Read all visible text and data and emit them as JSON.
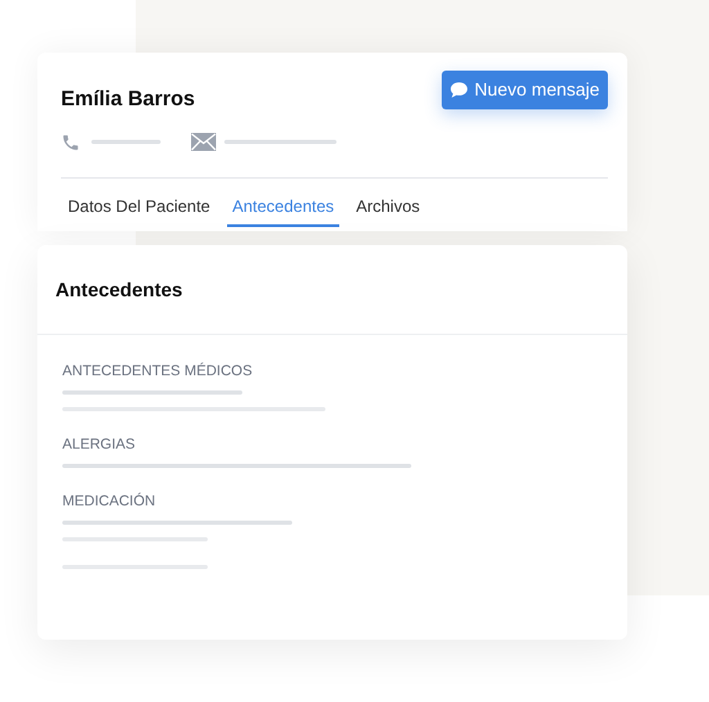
{
  "patient": {
    "name": "Emília Barros"
  },
  "new_message_button": {
    "label": "Nuevo mensaje"
  },
  "tabs": [
    {
      "label": "Datos Del Paciente",
      "selected": false
    },
    {
      "label": "Antecedentes",
      "selected": true
    },
    {
      "label": "Archivos",
      "selected": false
    }
  ],
  "panel": {
    "title": "Antecedentes",
    "sections": [
      {
        "label": "ANTECEDENTES MÉDICOS"
      },
      {
        "label": "ALERGIAS"
      },
      {
        "label": "MEDICACIÓN"
      }
    ]
  }
}
